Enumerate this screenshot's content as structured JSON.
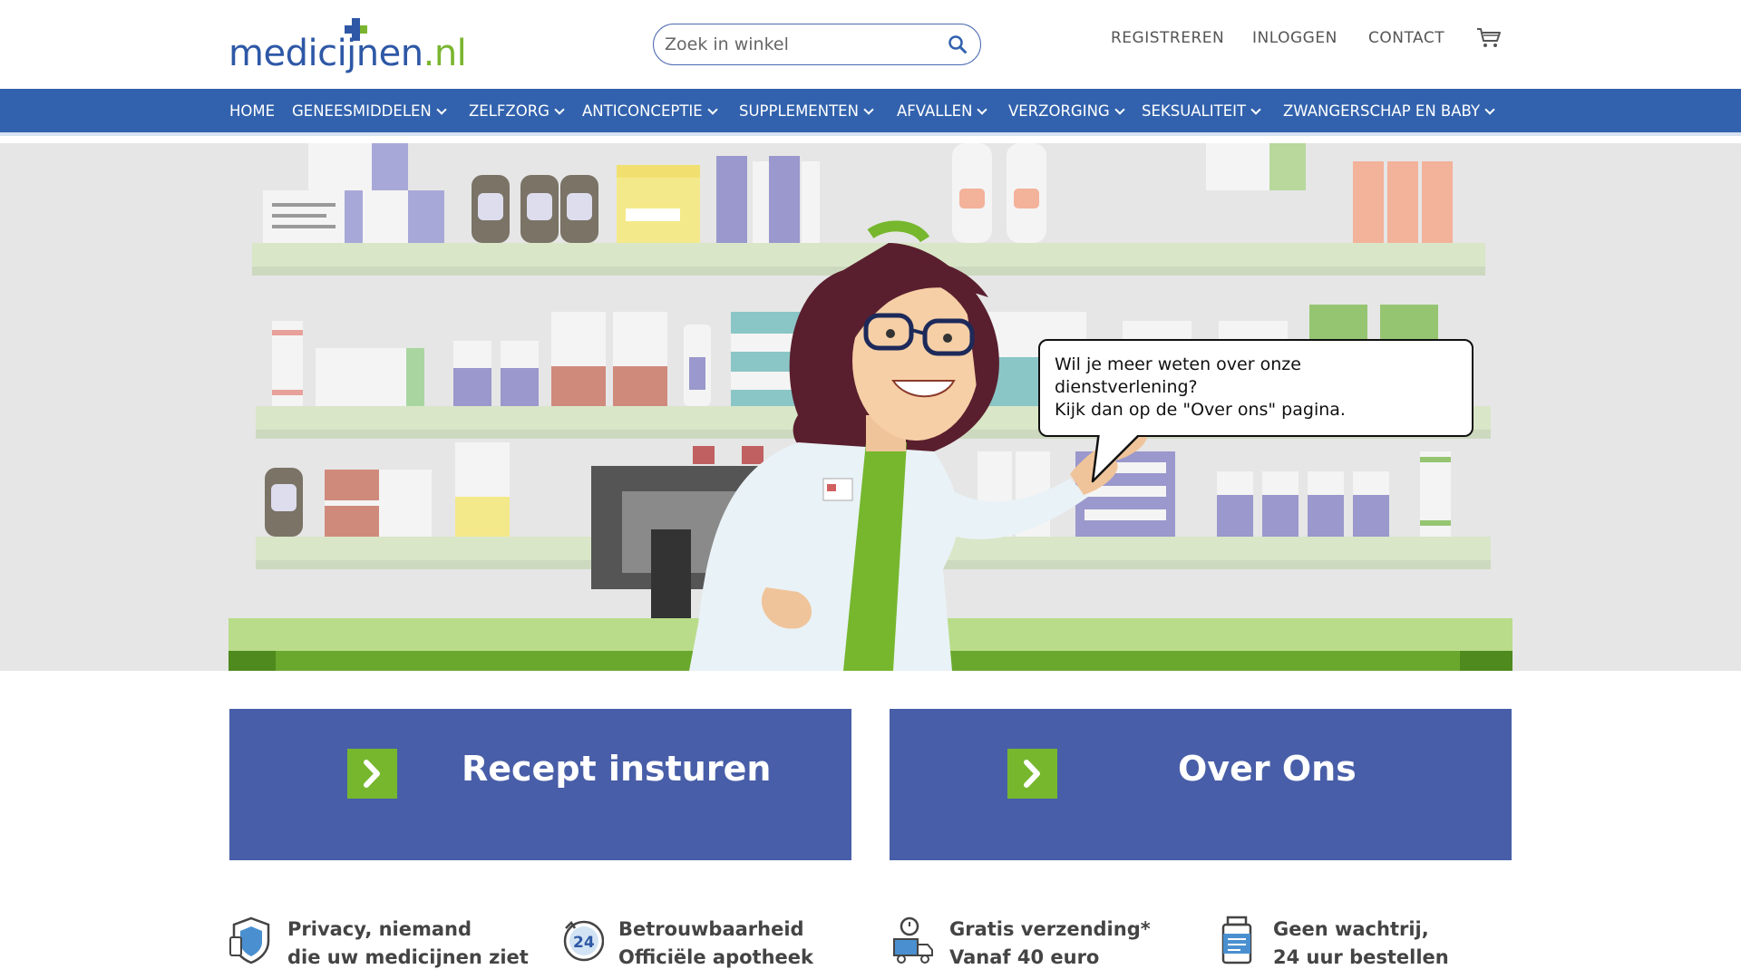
{
  "brand": {
    "name": "medicijnen",
    "tld": ".nl",
    "primary_color": "#3262ad",
    "accent_color": "#76b72e",
    "cta_color": "#485ea8"
  },
  "search": {
    "placeholder": "Zoek in winkel",
    "icon": "search-icon"
  },
  "top_links": {
    "register": "REGISTREREN",
    "login": "INLOGGEN",
    "contact": "CONTACT",
    "cart_icon": "cart-icon"
  },
  "nav": {
    "home": "HOME",
    "items": [
      "GENEESMIDDELEN",
      "ZELFZORG",
      "ANTICONCEPTIE",
      "SUPPLEMENTEN",
      "AFVALLEN",
      "VERZORGING",
      "SEKSUALITEIT",
      "ZWANGERSCHAP EN BABY"
    ]
  },
  "hero": {
    "bubble": {
      "line1": "Wil je meer weten over onze",
      "line2": "dienstverlening?",
      "line3": "Kijk dan op de \"Over ons\" pagina."
    }
  },
  "cta": {
    "recept": "Recept insturen",
    "over": "Over Ons",
    "arrow_icon": "chevron-right-icon"
  },
  "usps": [
    {
      "icon": "privacy-shield-icon",
      "line1": "Privacy, niemand",
      "line2": "die uw medicijnen ziet"
    },
    {
      "icon": "24h-clock-icon",
      "line1": "Betrouwbaarheid",
      "line2": "Officiële apotheek"
    },
    {
      "icon": "delivery-truck-icon",
      "line1": "Gratis verzending*",
      "line2": "Vanaf 40 euro"
    },
    {
      "icon": "pill-bottle-icon",
      "line1": "Geen wachtrij,",
      "line2": "24 uur bestellen"
    }
  ]
}
